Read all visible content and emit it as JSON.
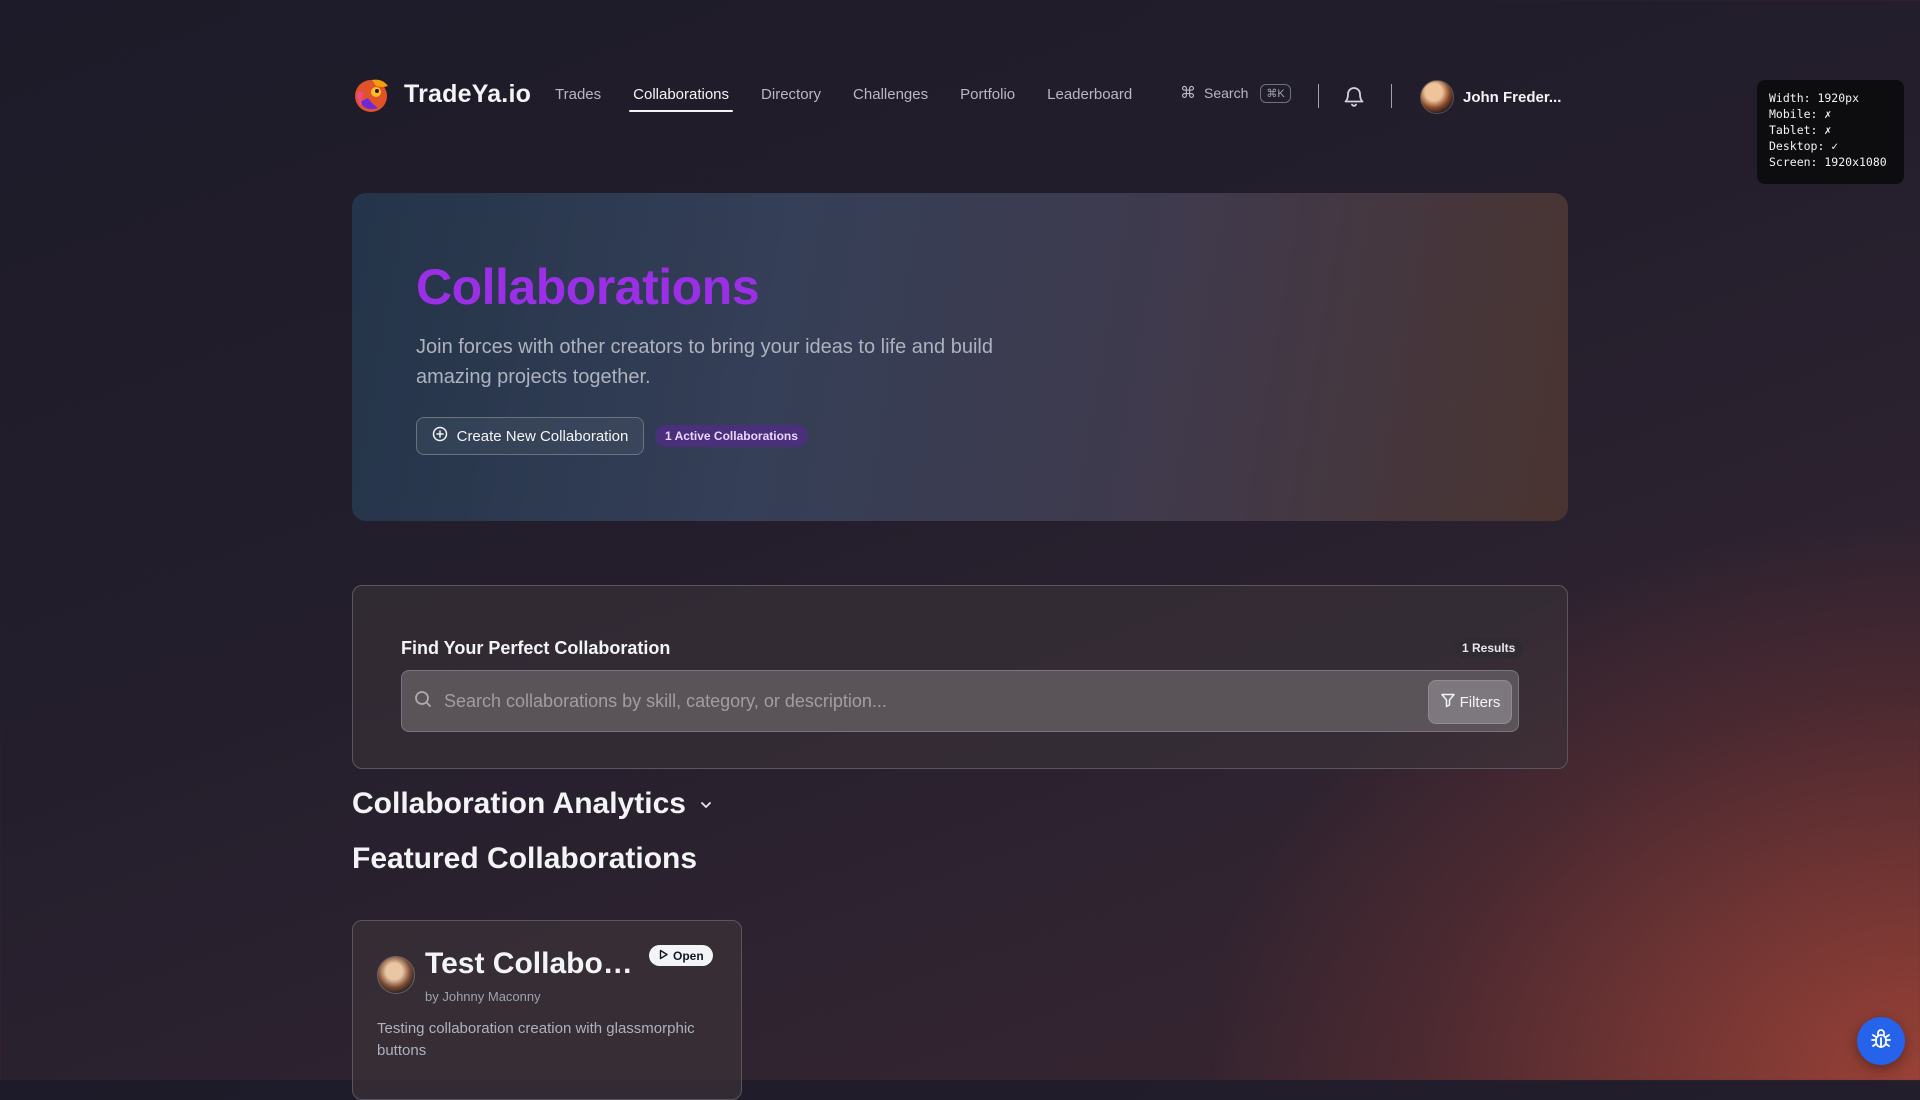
{
  "brand": {
    "name": "TradeYa.io",
    "logo_icon": "tradeya-logo-icon"
  },
  "nav": {
    "items": [
      {
        "label": "Trades",
        "active": false
      },
      {
        "label": "Collaborations",
        "active": true
      },
      {
        "label": "Directory",
        "active": false
      },
      {
        "label": "Challenges",
        "active": false
      },
      {
        "label": "Portfolio",
        "active": false
      },
      {
        "label": "Leaderboard",
        "active": false
      }
    ],
    "search_label": "Search",
    "search_shortcut": "⌘K",
    "user_name": "John Freder..."
  },
  "debug": {
    "width": "Width: 1920px",
    "mobile": "Mobile: ✗",
    "tablet": "Tablet: ✗",
    "desktop": "Desktop: ✓",
    "screen": "Screen: 1920x1080"
  },
  "hero": {
    "title": "Collaborations",
    "subtitle": "Join forces with other creators to bring your ideas to life and build amazing projects together.",
    "create_button": "Create New Collaboration",
    "active_badge": "1 Active Collaborations"
  },
  "search_panel": {
    "title": "Find Your Perfect Collaboration",
    "results_badge": "1 Results",
    "placeholder": "Search collaborations by skill, category, or description...",
    "filters_button": "Filters"
  },
  "sections": {
    "analytics_title": "Collaboration Analytics",
    "featured_title": "Featured Collaborations"
  },
  "card": {
    "title": "Test Collaboration",
    "author": "by Johnny Maconny",
    "status": "Open",
    "description": "Testing collaboration creation with glassmorphic buttons"
  },
  "colors": {
    "hero_title": "#9b2fe6",
    "active_badge_bg": "#4a2f7a",
    "bug_button": "#2563eb"
  }
}
